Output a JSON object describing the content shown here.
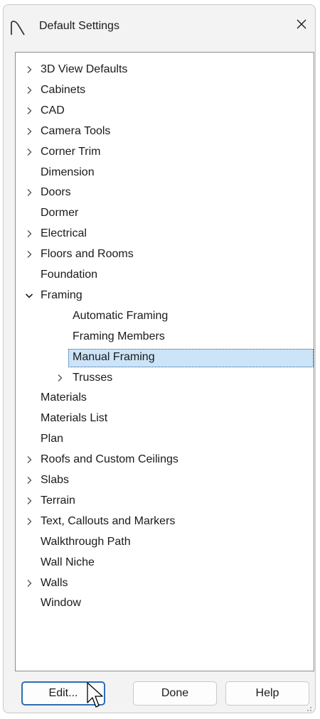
{
  "window": {
    "title": "Default Settings",
    "app_icon": "arch-icon",
    "close_icon": "close-icon"
  },
  "tree": {
    "items": [
      {
        "label": "3D View Defaults",
        "expandable": true,
        "expanded": false,
        "level": 0
      },
      {
        "label": "Cabinets",
        "expandable": true,
        "expanded": false,
        "level": 0
      },
      {
        "label": "CAD",
        "expandable": true,
        "expanded": false,
        "level": 0
      },
      {
        "label": "Camera Tools",
        "expandable": true,
        "expanded": false,
        "level": 0
      },
      {
        "label": "Corner Trim",
        "expandable": true,
        "expanded": false,
        "level": 0
      },
      {
        "label": "Dimension",
        "expandable": false,
        "level": 0
      },
      {
        "label": "Doors",
        "expandable": true,
        "expanded": false,
        "level": 0
      },
      {
        "label": "Dormer",
        "expandable": false,
        "level": 0
      },
      {
        "label": "Electrical",
        "expandable": true,
        "expanded": false,
        "level": 0
      },
      {
        "label": "Floors and Rooms",
        "expandable": true,
        "expanded": false,
        "level": 0
      },
      {
        "label": "Foundation",
        "expandable": false,
        "level": 0
      },
      {
        "label": "Framing",
        "expandable": true,
        "expanded": true,
        "level": 0
      },
      {
        "label": "Automatic Framing",
        "expandable": false,
        "level": 1
      },
      {
        "label": "Framing Members",
        "expandable": false,
        "level": 1
      },
      {
        "label": "Manual Framing",
        "expandable": false,
        "level": 1,
        "selected": true
      },
      {
        "label": "Trusses",
        "expandable": true,
        "expanded": false,
        "level": 1
      },
      {
        "label": "Materials",
        "expandable": false,
        "level": 0
      },
      {
        "label": "Materials List",
        "expandable": false,
        "level": 0
      },
      {
        "label": "Plan",
        "expandable": false,
        "level": 0
      },
      {
        "label": "Roofs and Custom Ceilings",
        "expandable": true,
        "expanded": false,
        "level": 0
      },
      {
        "label": "Slabs",
        "expandable": true,
        "expanded": false,
        "level": 0
      },
      {
        "label": "Terrain",
        "expandable": true,
        "expanded": false,
        "level": 0
      },
      {
        "label": "Text, Callouts and Markers",
        "expandable": true,
        "expanded": false,
        "level": 0
      },
      {
        "label": "Walkthrough Path",
        "expandable": false,
        "level": 0
      },
      {
        "label": "Wall Niche",
        "expandable": false,
        "level": 0
      },
      {
        "label": "Walls",
        "expandable": true,
        "expanded": false,
        "level": 0
      },
      {
        "label": "Window",
        "expandable": false,
        "level": 0
      }
    ]
  },
  "buttons": {
    "edit": "Edit...",
    "done": "Done",
    "help": "Help"
  },
  "colors": {
    "selection_fill": "#cce4f7",
    "selection_border": "#1f5f9a",
    "default_button_border": "#2d6db5"
  }
}
